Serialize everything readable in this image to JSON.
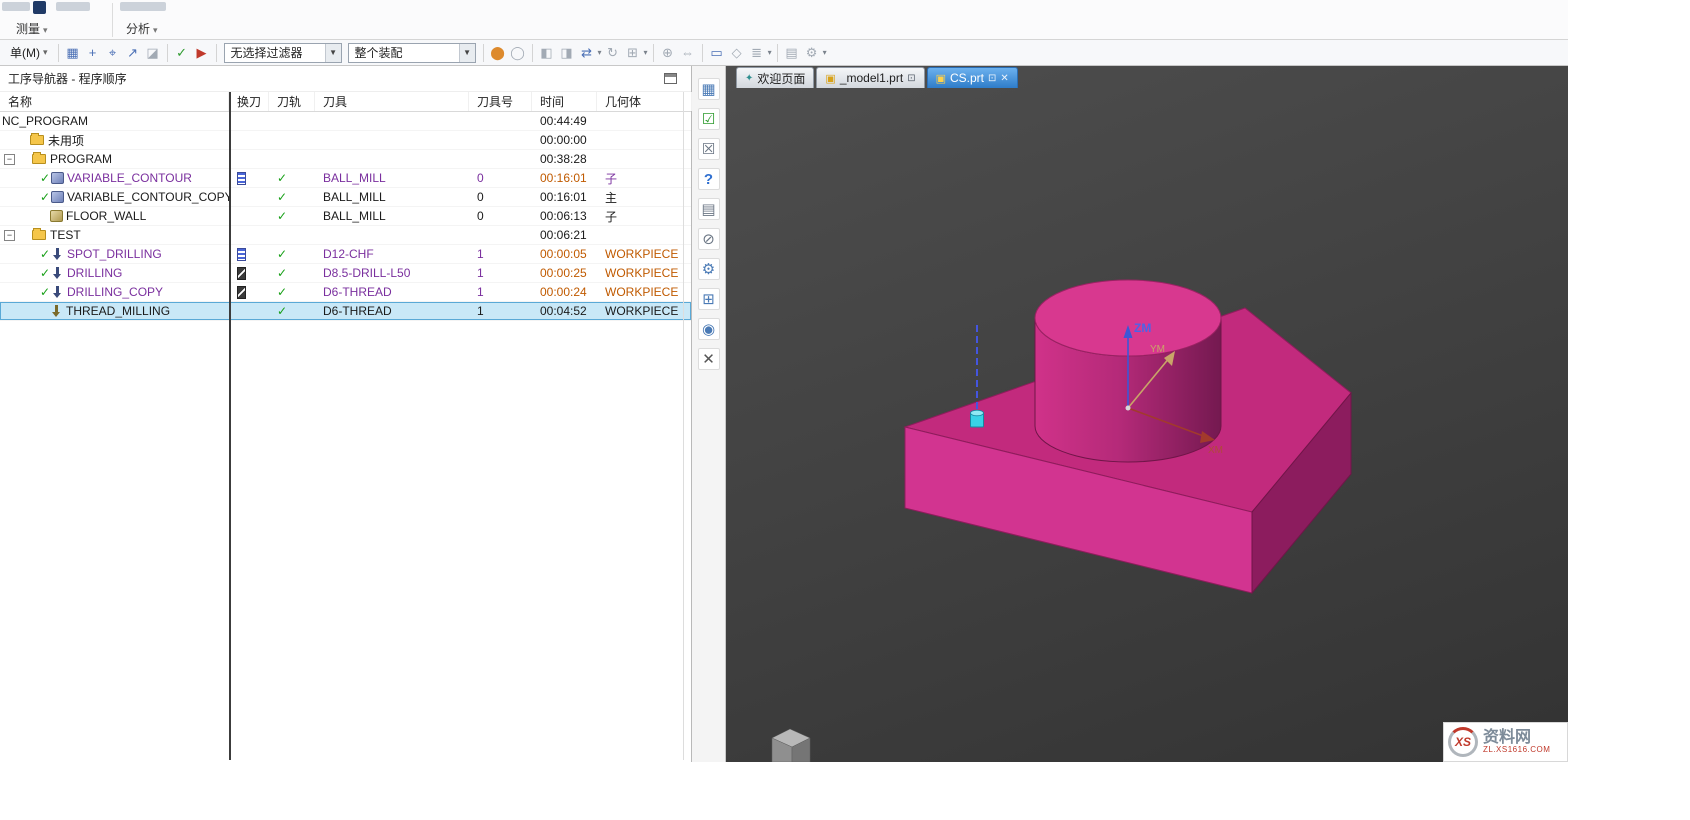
{
  "palette": {
    "purple_text": "#7a2f9e",
    "orange_text": "#c05a00",
    "check_green": "#18a018",
    "selection_bg": "#c9e8f7",
    "part_front": "#d23490",
    "part_top": "#c22a7d",
    "part_right": "#8c1c5e",
    "active_tab_blue": "#2e7cc9",
    "viewport_bg": "#3f3f3f"
  },
  "icons": {
    "check": "✓",
    "minus": "−",
    "close": "✕",
    "window": "⊡",
    "caret": "▼",
    "caret_small": "▾",
    "part": "▣",
    "star": "✦"
  },
  "ribbon": {
    "measure_label": "测量",
    "analysis_label": "分析"
  },
  "toolbar": {
    "menu_label": "单(M)",
    "selection_filter": "无选择过滤器",
    "assembly_scope": "整个装配",
    "left_icons": [
      {
        "name": "grid-snap-icon",
        "glyph": "▦"
      },
      {
        "name": "csys-icon",
        "glyph": "+"
      },
      {
        "name": "point-snap-icon",
        "glyph": "⌖"
      },
      {
        "name": "vector-icon",
        "glyph": "↗"
      },
      {
        "name": "plane-icon",
        "glyph": "◪"
      }
    ],
    "mid_icons": [
      {
        "name": "mcs-check-icon",
        "glyph": "✓"
      },
      {
        "name": "simulate-play-icon",
        "glyph": "▶"
      }
    ],
    "right_icons": [
      {
        "name": "shaded-ball-icon",
        "glyph": "⬤"
      },
      {
        "name": "wireframe-ball-icon",
        "glyph": "◯"
      },
      {
        "name": "section-view-icon",
        "glyph": "◧"
      },
      {
        "name": "clip-section-icon",
        "glyph": "◨"
      },
      {
        "name": "swap-view-icon",
        "glyph": "⇄"
      },
      {
        "name": "rotate-view-icon",
        "glyph": "↻"
      },
      {
        "name": "fit-view-icon",
        "glyph": "⊞"
      },
      {
        "name": "zoom-icon",
        "glyph": "⊕"
      },
      {
        "name": "pan-icon",
        "glyph": "⇔"
      },
      {
        "name": "front-view-icon",
        "glyph": "▭"
      },
      {
        "name": "iso-view-icon",
        "glyph": "◇"
      },
      {
        "name": "layers-icon",
        "glyph": "≣"
      },
      {
        "name": "snapshot-icon",
        "glyph": "▤"
      },
      {
        "name": "settings-icon",
        "glyph": "⚙"
      }
    ]
  },
  "navigator": {
    "title": "工序导航器 - 程序顺序",
    "columns": {
      "name": "名称",
      "tool_change": "换刀",
      "toolpath": "刀轨",
      "tool": "刀具",
      "tool_number": "刀具号",
      "time": "时间",
      "geometry": "几何体"
    },
    "rows": [
      {
        "name": "NC_PROGRAM",
        "time": "00:44:49"
      },
      {
        "name": "未用项",
        "time": "00:00:00"
      },
      {
        "name": "PROGRAM",
        "time": "00:38:28"
      },
      {
        "name": "VARIABLE_CONTOUR",
        "tool": "BALL_MILL",
        "tool_number": "0",
        "time": "00:16:01",
        "geometry": "子"
      },
      {
        "name": "VARIABLE_CONTOUR_COPY",
        "tool": "BALL_MILL",
        "tool_number": "0",
        "time": "00:16:01",
        "geometry": "主"
      },
      {
        "name": "FLOOR_WALL",
        "tool": "BALL_MILL",
        "tool_number": "0",
        "time": "00:06:13",
        "geometry": "子"
      },
      {
        "name": "TEST",
        "time": "00:06:21"
      },
      {
        "name": "SPOT_DRILLING",
        "tool": "D12-CHF",
        "tool_number": "1",
        "time": "00:00:05",
        "geometry": "WORKPIECE"
      },
      {
        "name": "DRILLING",
        "tool": "D8.5-DRILL-L50",
        "tool_number": "1",
        "time": "00:00:25",
        "geometry": "WORKPIECE"
      },
      {
        "name": "DRILLING_COPY",
        "tool": "D6-THREAD",
        "tool_number": "1",
        "time": "00:00:24",
        "geometry": "WORKPIECE"
      },
      {
        "name": "THREAD_MILLING",
        "tool": "D6-THREAD",
        "tool_number": "1",
        "time": "00:04:52",
        "geometry": "WORKPIECE"
      }
    ]
  },
  "resource_bar": [
    {
      "name": "assembly-navigator-icon",
      "glyph": "▦"
    },
    {
      "name": "part-navigator-icon",
      "glyph": "☑"
    },
    {
      "name": "constraint-navigator-icon",
      "glyph": "☒"
    },
    {
      "name": "help-icon",
      "glyph": "?"
    },
    {
      "name": "documentation-icon",
      "glyph": "▤"
    },
    {
      "name": "unused-filter-icon",
      "glyph": "⊘"
    },
    {
      "name": "machining-wizard-icon",
      "glyph": "⚙"
    },
    {
      "name": "operation-navigator-icon",
      "glyph": "⊞"
    },
    {
      "name": "roles-icon",
      "glyph": "◉"
    },
    {
      "name": "close-panel-icon",
      "glyph": "✕"
    }
  ],
  "tabs": {
    "welcome": "欢迎页面",
    "model": "_model1.prt",
    "active": "CS.prt"
  },
  "viewport_labels": {
    "z": "ZM",
    "y": "YM",
    "x": "XM"
  },
  "watermark": {
    "logo": "XS",
    "site": "资料网",
    "domain": "ZL.XS1616.COM"
  }
}
